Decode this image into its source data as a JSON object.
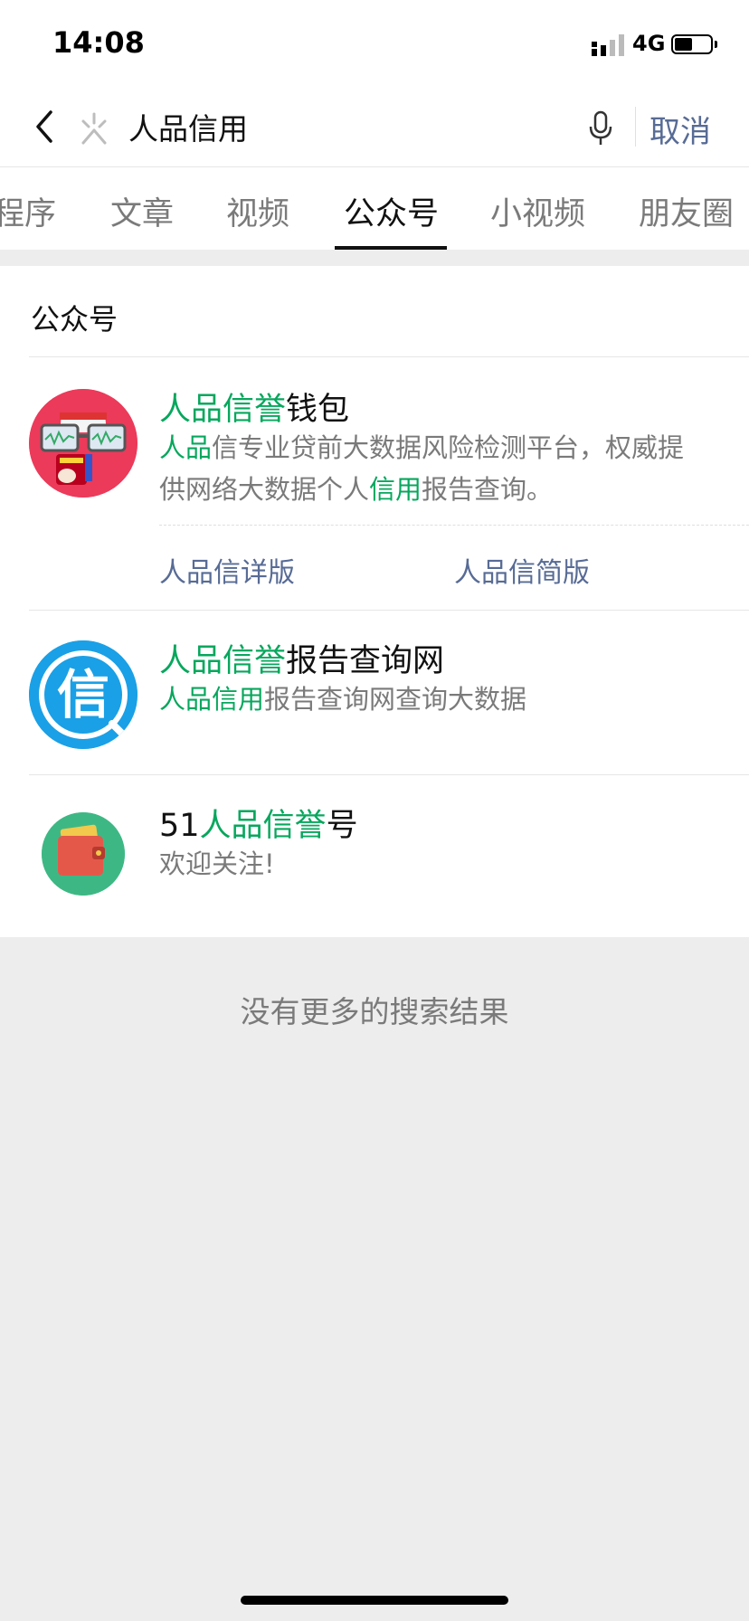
{
  "status_bar": {
    "time": "14:08",
    "network": "4G",
    "battery_level": 0.5
  },
  "search": {
    "query": "人品信用",
    "cancel_label": "取消"
  },
  "tabs": [
    {
      "label": "程序"
    },
    {
      "label": "文章"
    },
    {
      "label": "视频"
    },
    {
      "label": "公众号",
      "active": true
    },
    {
      "label": "小视频"
    },
    {
      "label": "朋友圈"
    }
  ],
  "section_title": "公众号",
  "results": [
    {
      "title_hl": "人品信誉",
      "title_rest": "钱包",
      "desc_line1_hl": "人品",
      "desc_line1_rest": "信专业贷前大数据风险检测平台，权威提",
      "desc_line2_pre": "供网络大数据个人",
      "desc_line2_hl": "信用",
      "desc_line2_post": "报告查询。",
      "links": [
        "人品信详版",
        "人品信简版"
      ]
    },
    {
      "title_hl": "人品信誉",
      "title_rest": "报告查询网",
      "desc_hl": "人品信用",
      "desc_rest": "报告查询网查询大数据",
      "avatar_char": "信"
    },
    {
      "title_pre": "51",
      "title_hl": "人品信誉",
      "title_post": "号",
      "desc": "欢迎关注!"
    }
  ],
  "no_more_text": "没有更多的搜索结果",
  "colors": {
    "highlight": "#07a75d",
    "link": "#576b95",
    "background": "#ededed"
  }
}
